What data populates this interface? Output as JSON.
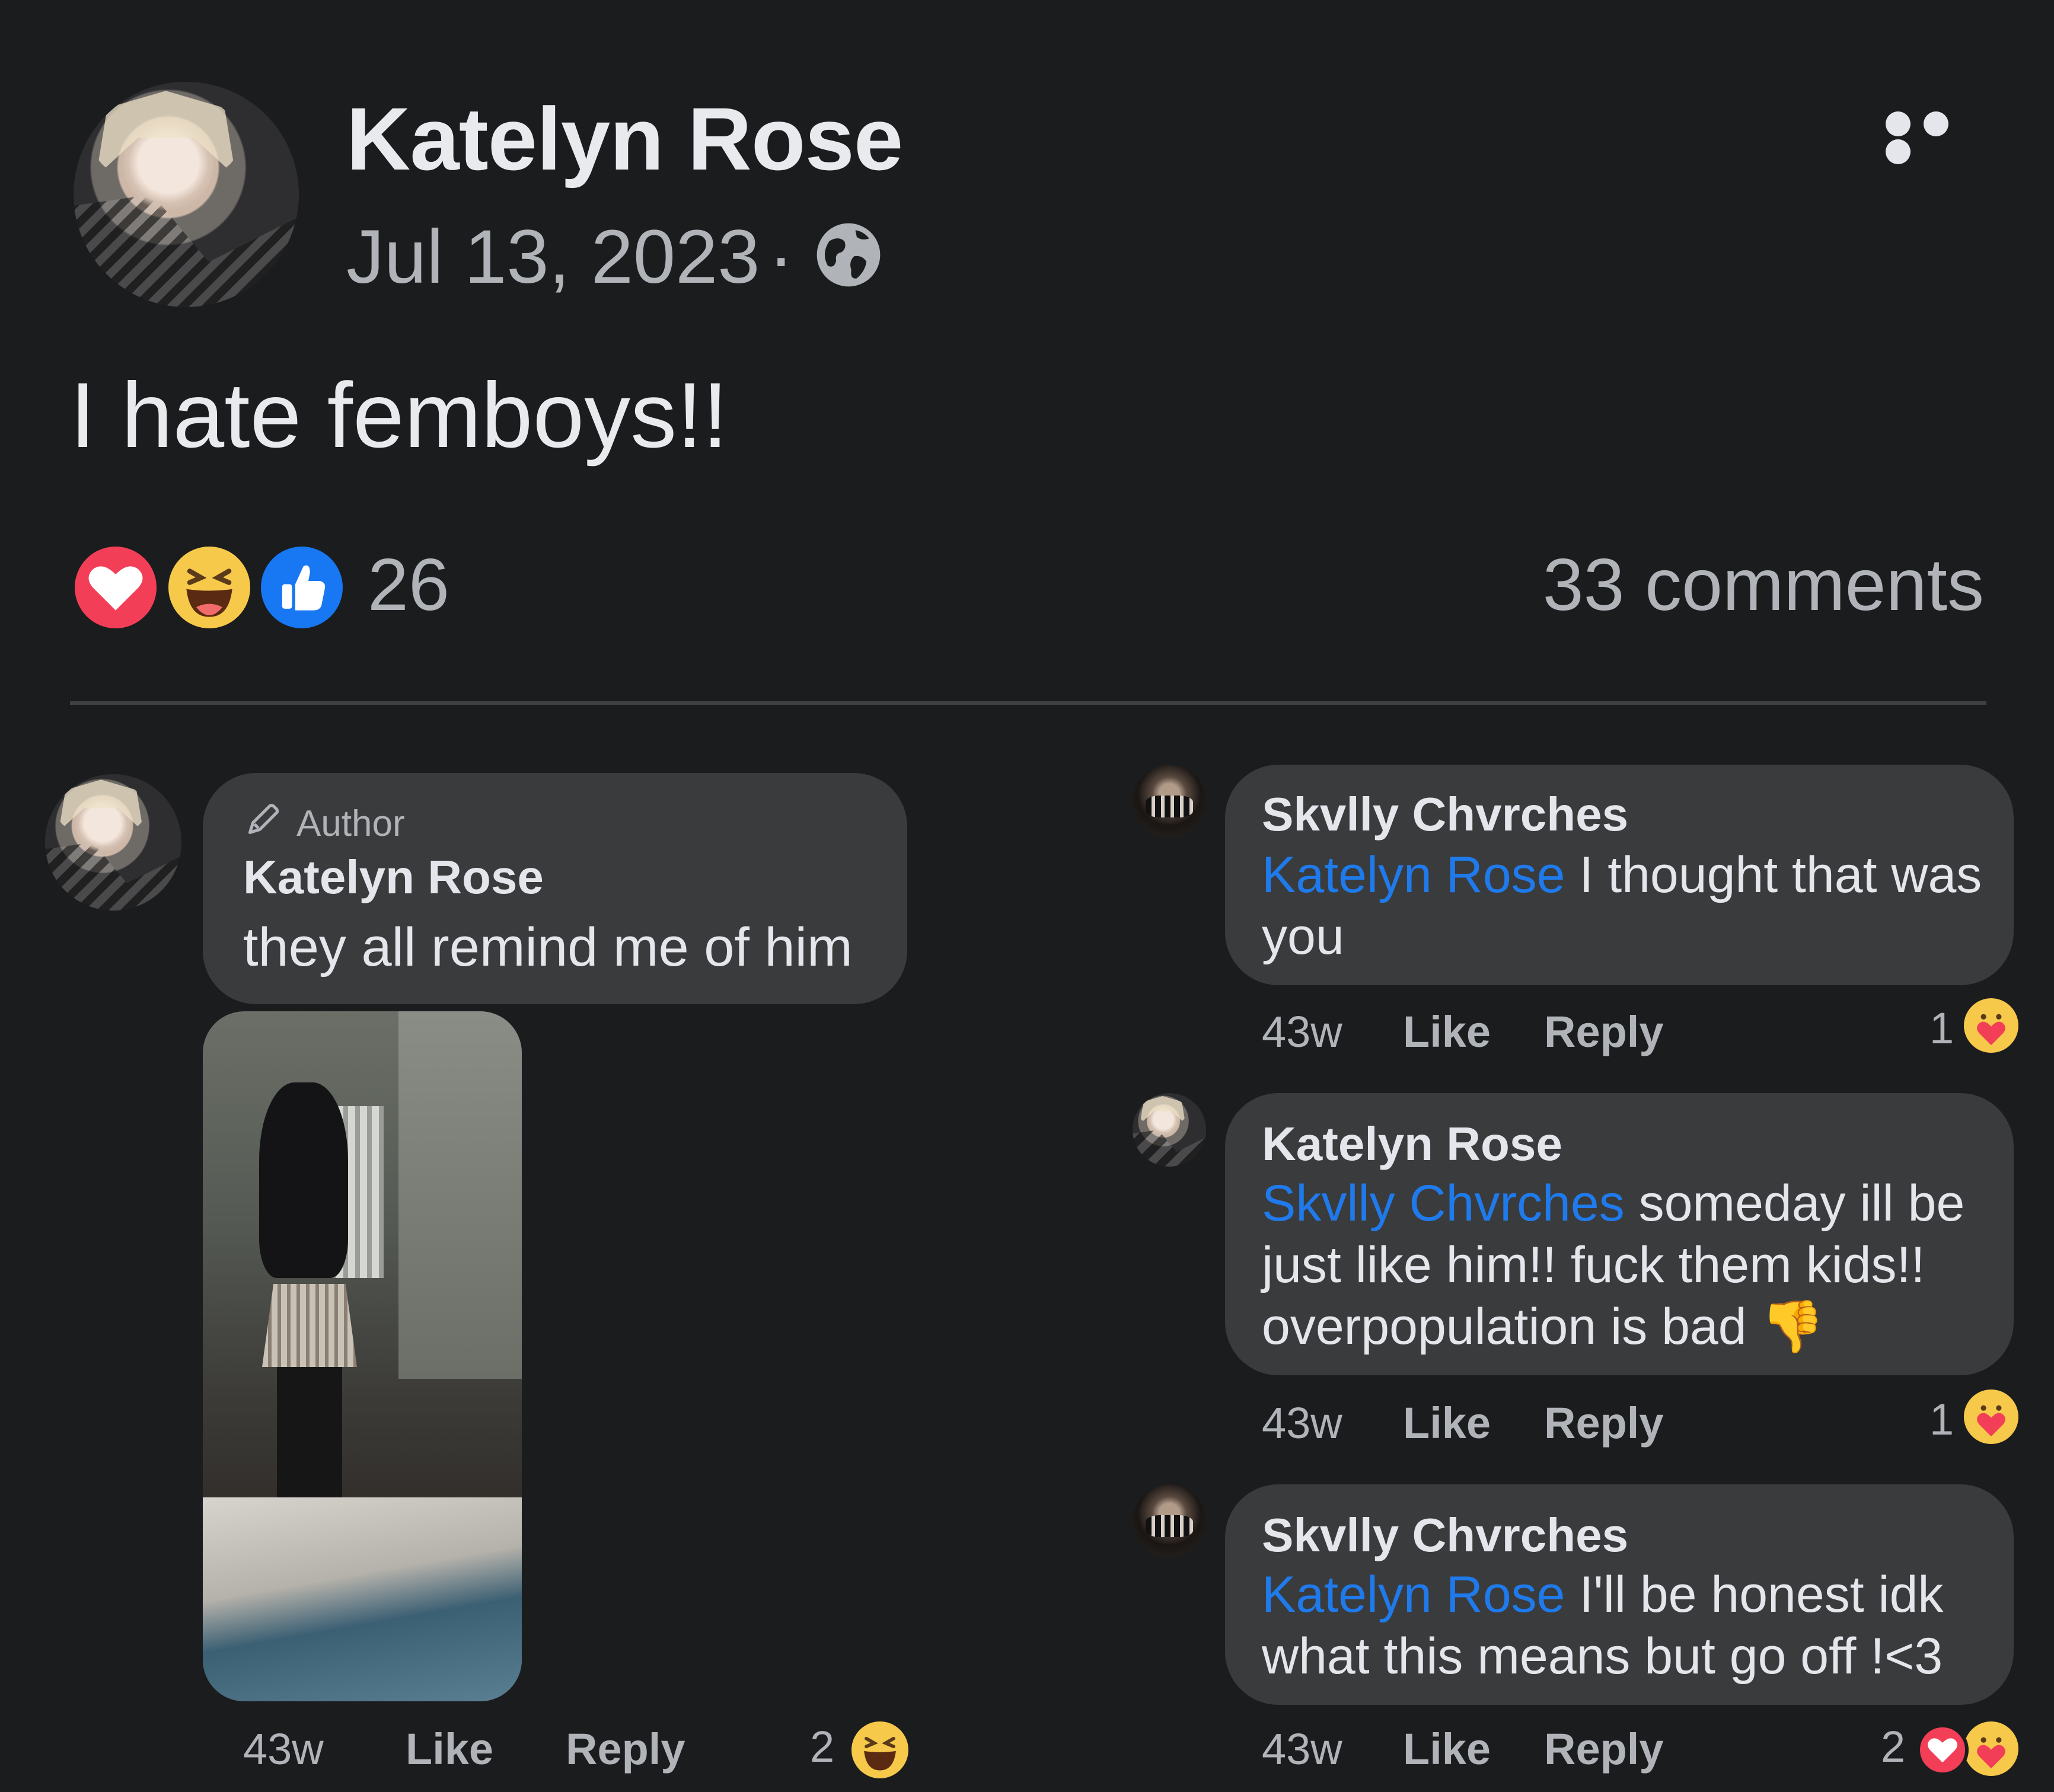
{
  "post": {
    "author": "Katelyn Rose",
    "date": "Jul 13, 2023",
    "separator": "·",
    "visibility_icon": "globe-icon",
    "text": "I hate femboys!!",
    "reactions": [
      "love",
      "haha",
      "like"
    ],
    "reaction_count": "26",
    "comment_count": "33 comments"
  },
  "comments": [
    {
      "badge": "Author",
      "name": "Katelyn Rose",
      "text": "they all remind me of him",
      "has_photo": true,
      "time": "43w",
      "like": "Like",
      "reply": "Reply",
      "reaction_count": "2",
      "reactions": [
        "haha"
      ]
    },
    {
      "name": "Skvlly Chvrches",
      "mention": "Katelyn Rose",
      "text_line1": " I thought that was",
      "text_line2": "you",
      "time": "43w",
      "like": "Like",
      "reply": "Reply",
      "reaction_count": "1",
      "reactions": [
        "care"
      ]
    },
    {
      "name": "Katelyn Rose",
      "mention": "Skvlly Chvrches",
      "text_line1": " someday ill be",
      "text_line2": "just like him!! fuck them kids!!",
      "text_line3": "overpopulation is bad",
      "emoji": "👎",
      "time": "43w",
      "like": "Like",
      "reply": "Reply",
      "reaction_count": "1",
      "reactions": [
        "care"
      ]
    },
    {
      "name": "Skvlly Chvrches",
      "mention": "Katelyn Rose",
      "text_line1": " I'll be honest idk",
      "text_line2": "what this means but go off !<3",
      "time": "43w",
      "like": "Like",
      "reply": "Reply",
      "reaction_count": "2",
      "reactions": [
        "love",
        "care"
      ]
    }
  ],
  "colors": {
    "background": "#1b1c1e",
    "bubble": "#3a3b3c",
    "mention": "#1f7aec",
    "muted_text": "#b0b3b8",
    "love": "#f33e58",
    "haha": "#f7c94a",
    "like": "#1877f2"
  }
}
